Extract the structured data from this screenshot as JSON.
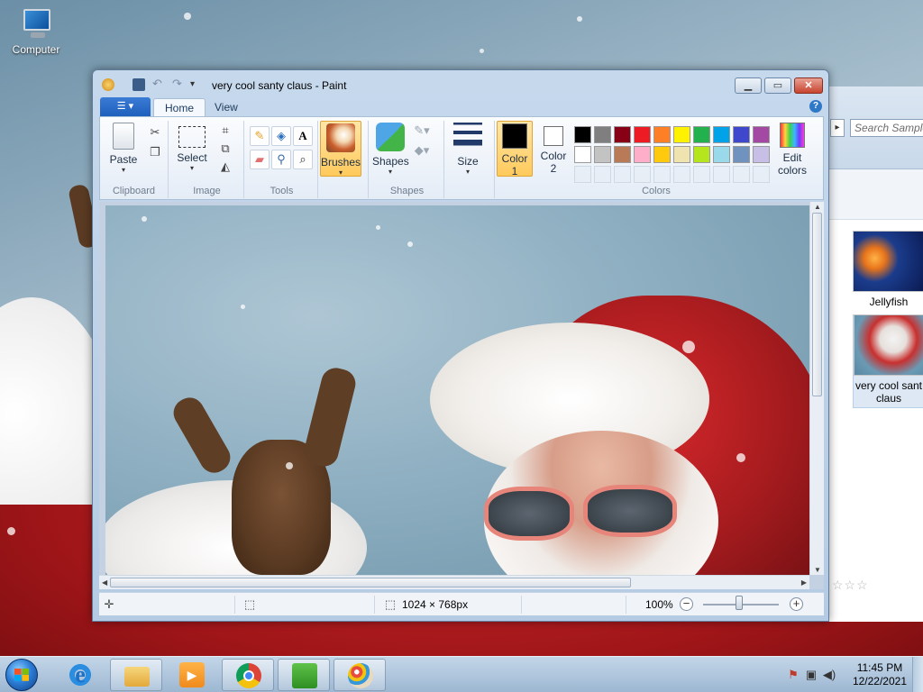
{
  "desktop": {
    "icon_label": "Computer"
  },
  "explorer": {
    "search_placeholder": "Search Sample",
    "items": [
      {
        "label": "Jellyfish"
      },
      {
        "label": "very cool sant claus"
      }
    ],
    "stars": "☆☆☆"
  },
  "paint": {
    "title": "very cool santy claus - Paint",
    "file_tab_icon": "menu-icon",
    "tabs": [
      {
        "label": "Home"
      },
      {
        "label": "View"
      }
    ],
    "help": "?",
    "groups": {
      "clipboard": {
        "label": "Clipboard",
        "paste": "Paste"
      },
      "image": {
        "label": "Image",
        "select": "Select"
      },
      "tools": {
        "label": "Tools"
      },
      "brushes": {
        "label": "Brushes"
      },
      "shapes": {
        "label": "Shapes",
        "shapes_btn": "Shapes"
      },
      "size": {
        "label": "Size"
      },
      "colors": {
        "label": "Colors",
        "color1": "Color",
        "color1_num": "1",
        "color2": "Color",
        "color2_num": "2",
        "edit": "Edit",
        "edit2": "colors",
        "color1_value": "#000000",
        "color2_value": "#ffffff",
        "palette_row1": [
          "#000000",
          "#7f7f7f",
          "#880015",
          "#ed1c24",
          "#ff7f27",
          "#fff200",
          "#22b14c",
          "#00a2e8",
          "#3f48cc",
          "#a349a4"
        ],
        "palette_row2": [
          "#ffffff",
          "#c3c3c3",
          "#b97a57",
          "#ffaec9",
          "#ffc90e",
          "#efe4b0",
          "#b5e61d",
          "#99d9ea",
          "#7092be",
          "#c8bfe7"
        ]
      }
    },
    "status": {
      "dimensions": "1024 × 768px",
      "zoom": "100%",
      "zoom_out": "−",
      "zoom_in": "+"
    }
  },
  "taskbar": {
    "time": "11:45 PM",
    "date": "12/22/2021",
    "apps": [
      "internet-explorer-icon",
      "file-explorer-icon",
      "media-player-icon",
      "chrome-icon",
      "notepad-icon",
      "paint-icon"
    ]
  }
}
